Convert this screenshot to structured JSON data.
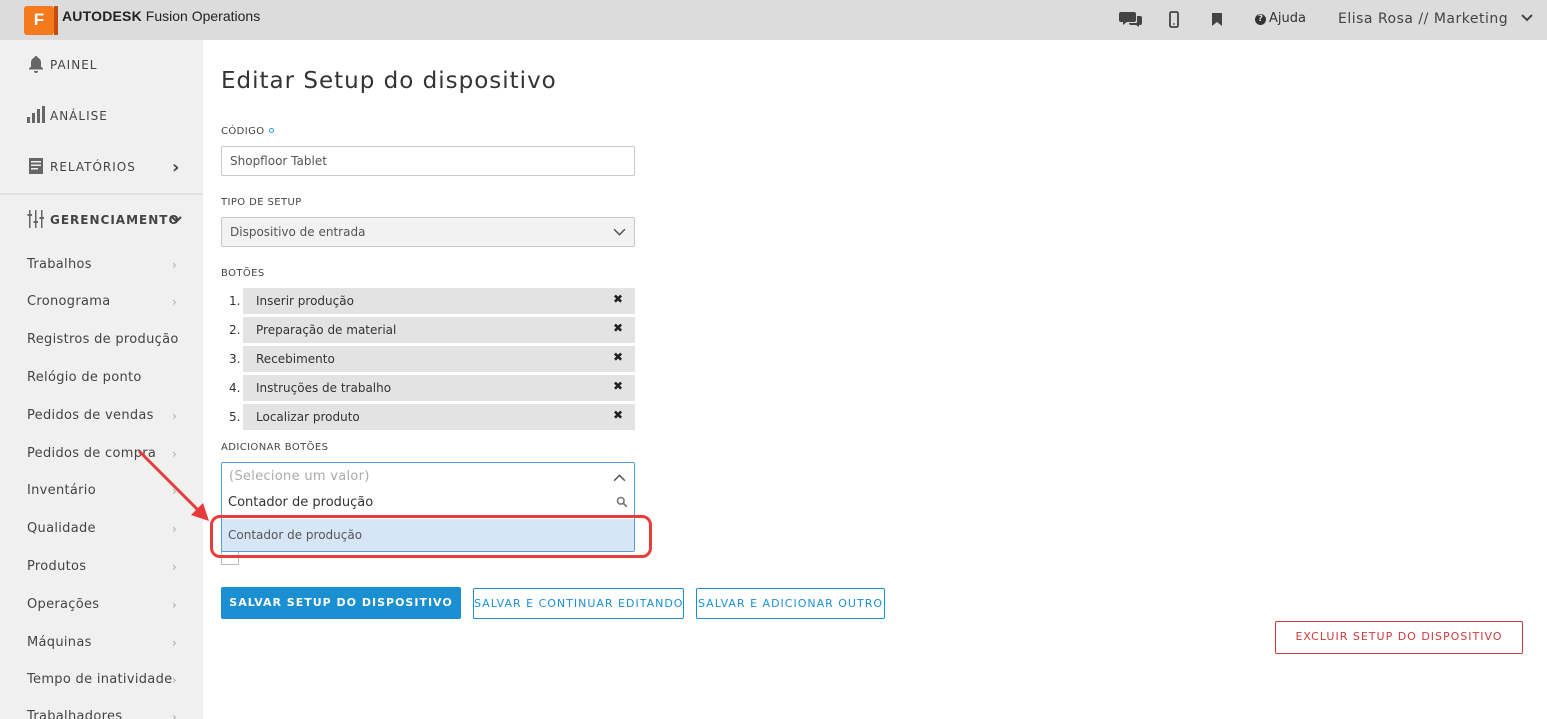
{
  "app": {
    "brand_bold": "AUTODESK",
    "brand_rest": "Fusion Operations",
    "logo_letter": "F",
    "accent_color": "#f57a1e"
  },
  "topbar": {
    "icons": [
      "chat-icon",
      "mobile-icon",
      "bookmark-icon"
    ],
    "help_label": "Ajuda",
    "user_label": "Elisa Rosa // Marketing"
  },
  "sidebar": {
    "main_items": [
      {
        "label": "PAINEL",
        "icon": "bell-icon"
      },
      {
        "label": "ANÁLISE",
        "icon": "bar-chart-icon"
      },
      {
        "label": "RELATÓRIOS",
        "icon": "report-icon",
        "chevron": "›"
      },
      {
        "label": "GERENCIAMENTO",
        "icon": "sliders-icon",
        "chevron": "⌄"
      }
    ],
    "sub_items": [
      {
        "label": "Trabalhos",
        "chevron": "›"
      },
      {
        "label": "Cronograma",
        "chevron": "›"
      },
      {
        "label": "Registros de produção",
        "chevron": ""
      },
      {
        "label": "Relógio de ponto",
        "chevron": ""
      },
      {
        "label": "Pedidos de vendas",
        "chevron": "›"
      },
      {
        "label": "Pedidos de compra",
        "chevron": "›"
      },
      {
        "label": "Inventário",
        "chevron": "›"
      },
      {
        "label": "Qualidade",
        "chevron": "›"
      },
      {
        "label": "Produtos",
        "chevron": "›"
      },
      {
        "label": "Operações",
        "chevron": "›"
      },
      {
        "label": "Máquinas",
        "chevron": "›"
      },
      {
        "label": "Tempo de inatividade",
        "chevron": "›"
      },
      {
        "label": "Trabalhadores",
        "chevron": "›"
      }
    ]
  },
  "form": {
    "title": "Editar Setup do dispositivo",
    "code_label": "CÓDIGO",
    "code_value": "Shopfloor Tablet",
    "setup_type_label": "TIPO DE SETUP",
    "setup_type_value": "Dispositivo de entrada",
    "buttons_label": "BOTÕES",
    "buttons": [
      {
        "num": "1.",
        "label": "Inserir produção",
        "remove": "✖"
      },
      {
        "num": "2.",
        "label": "Preparação de material",
        "remove": "✖"
      },
      {
        "num": "3.",
        "label": "Recebimento",
        "remove": "✖"
      },
      {
        "num": "4.",
        "label": "Instruções de trabalho",
        "remove": "✖"
      },
      {
        "num": "5.",
        "label": "Localizar produto",
        "remove": "✖"
      }
    ],
    "add_buttons_label": "ADICIONAR BOTÕES",
    "add_buttons_placeholder": "(Selecione um valor)",
    "search_value": "Contador de produção",
    "dropdown_option": "Contador de produção"
  },
  "actions": {
    "save": "SALVAR SETUP DO DISPOSITIVO",
    "save_continue": "SALVAR E CONTINUAR EDITANDO",
    "save_add": "SALVAR E ADICIONAR OUTRO",
    "delete": "EXCLUIR SETUP DO DISPOSITIVO"
  },
  "annotation": {
    "arrow_color": "#e83c3c"
  }
}
